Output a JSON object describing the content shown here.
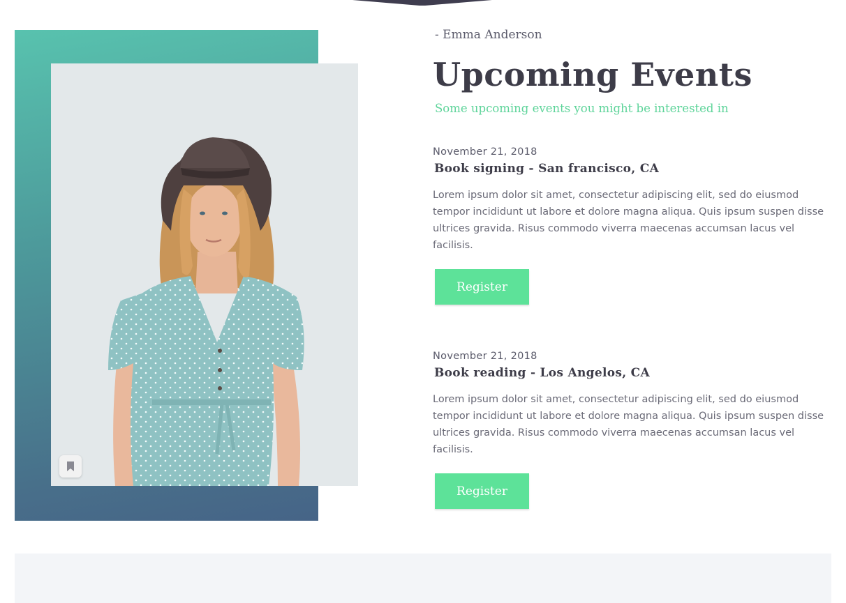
{
  "author": "- Emma Anderson",
  "section": {
    "title": "Upcoming Events",
    "subtitle": "Some upcoming events you might be interested in"
  },
  "events": [
    {
      "date": "November 21, 2018",
      "title": "Book signing - San francisco, CA",
      "description": "Lorem ipsum dolor sit amet, consectetur adipiscing elit, sed do eiusmod tempor incididunt ut labore et dolore magna aliqua. Quis ipsum suspen disse ultrices gravida. Risus commodo viverra maecenas accumsan lacus vel facilisis.",
      "button_label": "Register"
    },
    {
      "date": "November 21, 2018",
      "title": "Book reading - Los Angelos, CA",
      "description": "Lorem ipsum dolor sit amet, consectetur adipiscing elit, sed do eiusmod tempor incididunt ut labore et dolore magna aliqua. Quis ipsum suspen disse ultrices gravida. Risus commodo viverra maecenas accumsan lacus vel facilisis.",
      "button_label": "Register"
    }
  ],
  "icons": {
    "photo_badge": "bookmark-icon"
  },
  "colors": {
    "accent_green": "#5de299",
    "heading": "#3d3c48",
    "frame_top": "#58c2ae",
    "frame_bottom": "#466487"
  }
}
